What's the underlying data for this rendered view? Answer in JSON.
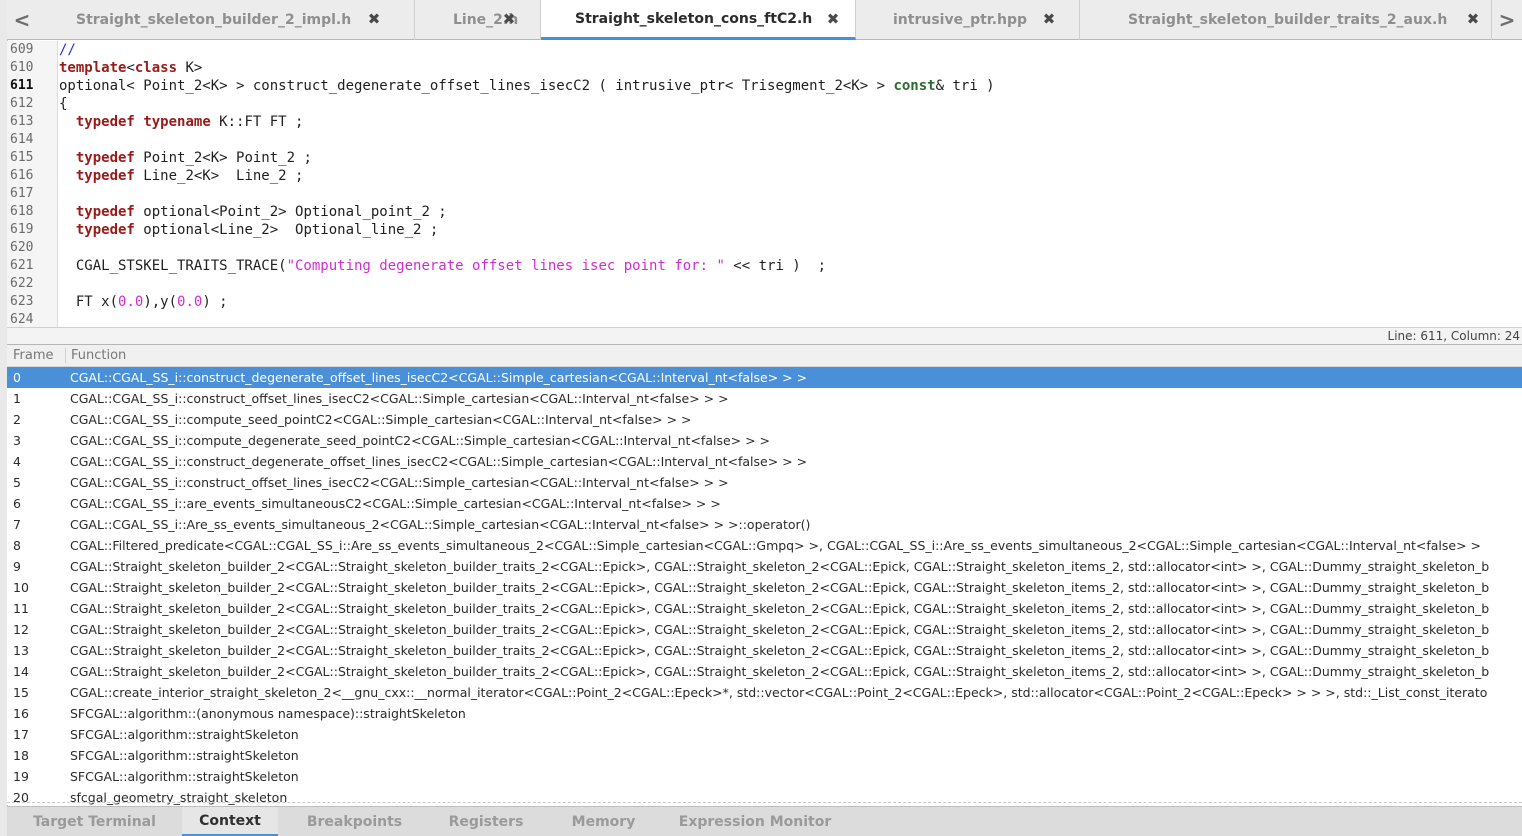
{
  "tabs": [
    {
      "label": "Straight_skeleton_builder_2_impl.h",
      "active": false
    },
    {
      "label": "Line_2.h",
      "active": false
    },
    {
      "label": "Straight_skeleton_cons_ftC2.h",
      "active": true
    },
    {
      "label": "intrusive_ptr.hpp",
      "active": false
    },
    {
      "label": "Straight_skeleton_builder_traits_2_aux.h",
      "active": false
    }
  ],
  "tab_arrows": {
    "left": "<",
    "right": ">"
  },
  "close_glyph": "✖",
  "editor": {
    "current_line": "611",
    "line_numbers": [
      "609",
      "610",
      "611",
      "612",
      "613",
      "614",
      "615",
      "616",
      "617",
      "618",
      "619",
      "620",
      "621",
      "622",
      "623",
      "624"
    ]
  },
  "status": {
    "position": "Line: 611, Column: 24"
  },
  "stack": {
    "headers": {
      "frame": "Frame",
      "function": "Function"
    },
    "selected_index": 0,
    "frames": [
      {
        "frame": "0",
        "function": "CGAL::CGAL_SS_i::construct_degenerate_offset_lines_isecC2<CGAL::Simple_cartesian<CGAL::Interval_nt<false> > >"
      },
      {
        "frame": "1",
        "function": "CGAL::CGAL_SS_i::construct_offset_lines_isecC2<CGAL::Simple_cartesian<CGAL::Interval_nt<false> > >"
      },
      {
        "frame": "2",
        "function": "CGAL::CGAL_SS_i::compute_seed_pointC2<CGAL::Simple_cartesian<CGAL::Interval_nt<false> > >"
      },
      {
        "frame": "3",
        "function": "CGAL::CGAL_SS_i::compute_degenerate_seed_pointC2<CGAL::Simple_cartesian<CGAL::Interval_nt<false> > >"
      },
      {
        "frame": "4",
        "function": "CGAL::CGAL_SS_i::construct_degenerate_offset_lines_isecC2<CGAL::Simple_cartesian<CGAL::Interval_nt<false> > >"
      },
      {
        "frame": "5",
        "function": "CGAL::CGAL_SS_i::construct_offset_lines_isecC2<CGAL::Simple_cartesian<CGAL::Interval_nt<false> > >"
      },
      {
        "frame": "6",
        "function": "CGAL::CGAL_SS_i::are_events_simultaneousC2<CGAL::Simple_cartesian<CGAL::Interval_nt<false> > >"
      },
      {
        "frame": "7",
        "function": "CGAL::CGAL_SS_i::Are_ss_events_simultaneous_2<CGAL::Simple_cartesian<CGAL::Interval_nt<false> > >::operator()"
      },
      {
        "frame": "8",
        "function": "CGAL::Filtered_predicate<CGAL::CGAL_SS_i::Are_ss_events_simultaneous_2<CGAL::Simple_cartesian<CGAL::Gmpq> >, CGAL::CGAL_SS_i::Are_ss_events_simultaneous_2<CGAL::Simple_cartesian<CGAL::Interval_nt<false> >"
      },
      {
        "frame": "9",
        "function": "CGAL::Straight_skeleton_builder_2<CGAL::Straight_skeleton_builder_traits_2<CGAL::Epick>, CGAL::Straight_skeleton_2<CGAL::Epick, CGAL::Straight_skeleton_items_2, std::allocator<int> >, CGAL::Dummy_straight_skeleton_b"
      },
      {
        "frame": "10",
        "function": "CGAL::Straight_skeleton_builder_2<CGAL::Straight_skeleton_builder_traits_2<CGAL::Epick>, CGAL::Straight_skeleton_2<CGAL::Epick, CGAL::Straight_skeleton_items_2, std::allocator<int> >, CGAL::Dummy_straight_skeleton_b"
      },
      {
        "frame": "11",
        "function": "CGAL::Straight_skeleton_builder_2<CGAL::Straight_skeleton_builder_traits_2<CGAL::Epick>, CGAL::Straight_skeleton_2<CGAL::Epick, CGAL::Straight_skeleton_items_2, std::allocator<int> >, CGAL::Dummy_straight_skeleton_b"
      },
      {
        "frame": "12",
        "function": "CGAL::Straight_skeleton_builder_2<CGAL::Straight_skeleton_builder_traits_2<CGAL::Epick>, CGAL::Straight_skeleton_2<CGAL::Epick, CGAL::Straight_skeleton_items_2, std::allocator<int> >, CGAL::Dummy_straight_skeleton_b"
      },
      {
        "frame": "13",
        "function": "CGAL::Straight_skeleton_builder_2<CGAL::Straight_skeleton_builder_traits_2<CGAL::Epick>, CGAL::Straight_skeleton_2<CGAL::Epick, CGAL::Straight_skeleton_items_2, std::allocator<int> >, CGAL::Dummy_straight_skeleton_b"
      },
      {
        "frame": "14",
        "function": "CGAL::Straight_skeleton_builder_2<CGAL::Straight_skeleton_builder_traits_2<CGAL::Epick>, CGAL::Straight_skeleton_2<CGAL::Epick, CGAL::Straight_skeleton_items_2, std::allocator<int> >, CGAL::Dummy_straight_skeleton_b"
      },
      {
        "frame": "15",
        "function": "CGAL::create_interior_straight_skeleton_2<__gnu_cxx::__normal_iterator<CGAL::Point_2<CGAL::Epeck>*, std::vector<CGAL::Point_2<CGAL::Epeck>, std::allocator<CGAL::Point_2<CGAL::Epeck> > > >, std::_List_const_iterato"
      },
      {
        "frame": "16",
        "function": "SFCGAL::algorithm::(anonymous namespace)::straightSkeleton"
      },
      {
        "frame": "17",
        "function": "SFCGAL::algorithm::straightSkeleton"
      },
      {
        "frame": "18",
        "function": "SFCGAL::algorithm::straightSkeleton"
      },
      {
        "frame": "19",
        "function": "SFCGAL::algorithm::straightSkeleton"
      },
      {
        "frame": "20",
        "function": "sfcgal_geometry_straight_skeleton"
      }
    ]
  },
  "bottom_tabs": [
    {
      "label": "Target Terminal",
      "active": false
    },
    {
      "label": "Context",
      "active": true
    },
    {
      "label": "Breakpoints",
      "active": false
    },
    {
      "label": "Registers",
      "active": false
    },
    {
      "label": "Memory",
      "active": false
    },
    {
      "label": "Expression Monitor",
      "active": false
    }
  ],
  "colors": {
    "accent": "#4a90d9",
    "keyword": "#9a1a1a",
    "string": "#d02dd0",
    "comment": "#2c2cd8"
  }
}
